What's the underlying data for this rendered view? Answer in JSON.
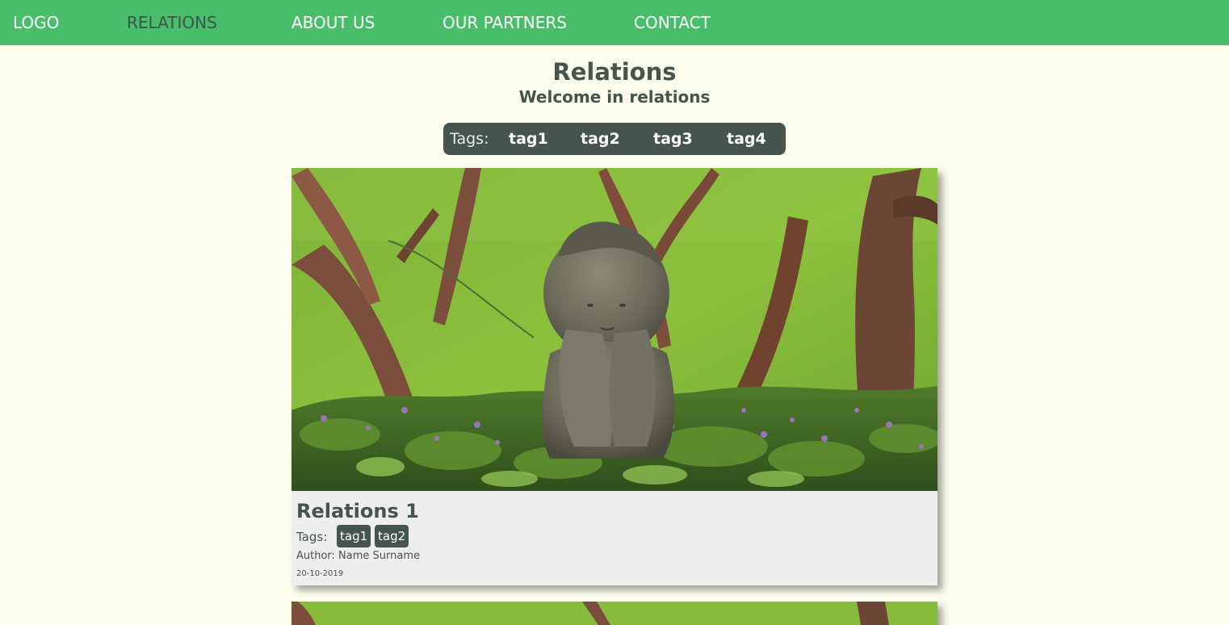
{
  "nav": {
    "logo": "LOGO",
    "items": [
      {
        "label": "RELATIONS",
        "active": true
      },
      {
        "label": "ABOUT US",
        "active": false
      },
      {
        "label": "OUR PARTNERS",
        "active": false
      },
      {
        "label": "CONTACT",
        "active": false
      }
    ]
  },
  "header": {
    "title": "Relations",
    "subtitle": "Welcome in relations"
  },
  "tagbar": {
    "label": "Tags:",
    "tags": [
      "tag1",
      "tag2",
      "tag3",
      "tag4"
    ]
  },
  "cards": [
    {
      "title": "Relations 1",
      "tags_label": "Tags:",
      "tags": [
        "tag1",
        "tag2"
      ],
      "author": "Author: Name Surname",
      "date": "20-10-2019",
      "image": "garden-statue-photo"
    }
  ],
  "colors": {
    "nav_bg": "#48be6a",
    "page_bg": "#fcfdec",
    "text": "#45554e",
    "tag_bg": "#45554e",
    "card_bg": "#eeeeee"
  }
}
